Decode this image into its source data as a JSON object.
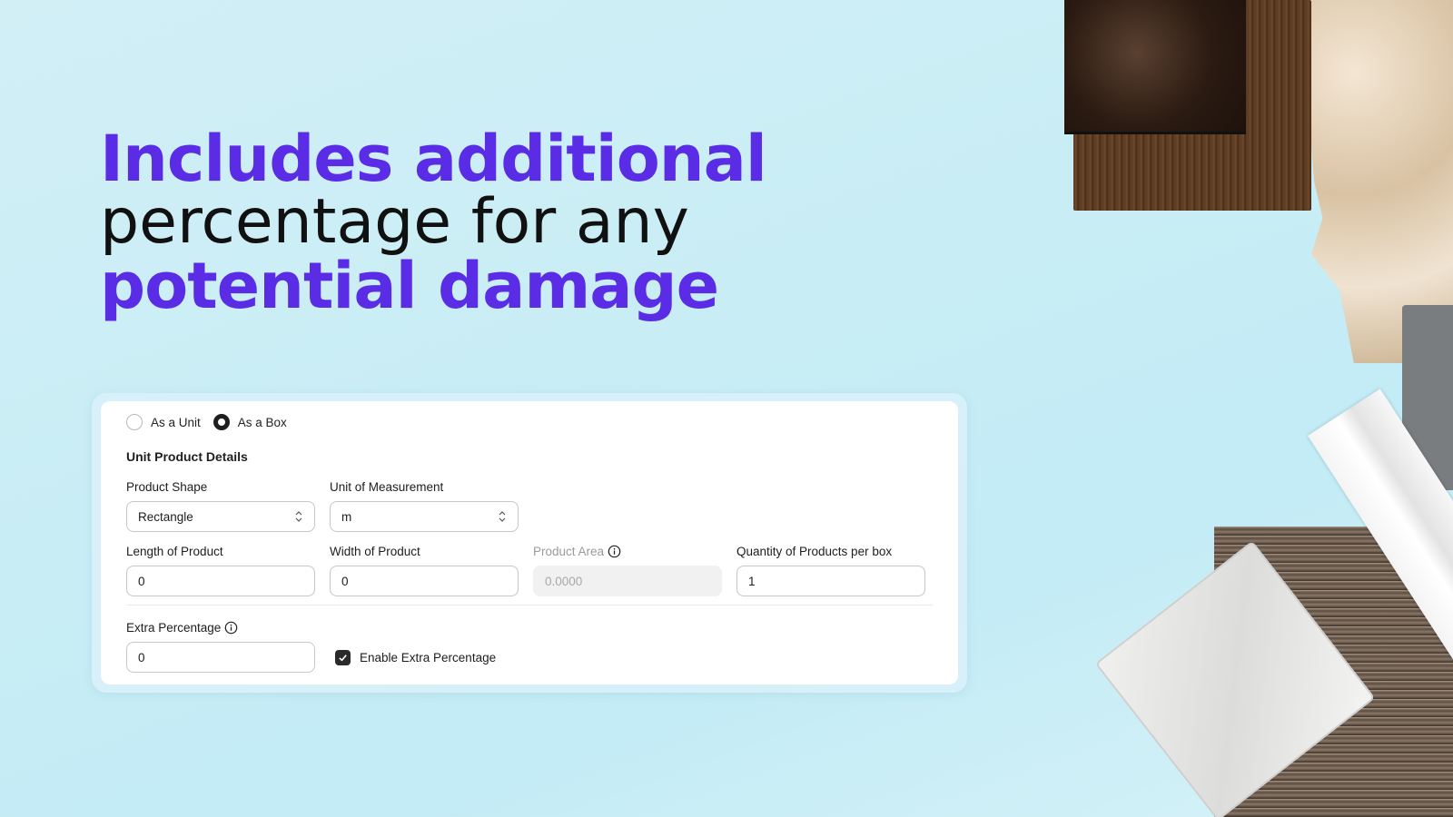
{
  "headline": {
    "line1": "Includes additional",
    "line2": "percentage for any",
    "line3": "potential damage"
  },
  "colors": {
    "accent": "#5a2ce6",
    "background": "#c8edf5"
  },
  "form": {
    "mode_options": [
      {
        "label": "As a Unit",
        "selected": false
      },
      {
        "label": "As a Box",
        "selected": true
      }
    ],
    "section_title": "Unit Product Details",
    "product_shape": {
      "label": "Product Shape",
      "value": "Rectangle",
      "icon": "chevron-up-down-icon"
    },
    "unit_of_measurement": {
      "label": "Unit of Measurement",
      "value": "m",
      "icon": "chevron-up-down-icon"
    },
    "length": {
      "label": "Length of Product",
      "value": "0"
    },
    "width": {
      "label": "Width of Product",
      "value": "0"
    },
    "area": {
      "label": "Product Area",
      "value": "0.0000",
      "icon": "info-icon",
      "disabled": true
    },
    "quantity_per_box": {
      "label": "Quantity of Products per box",
      "value": "1"
    },
    "extra_percentage": {
      "label": "Extra Percentage",
      "value": "0",
      "icon": "info-icon"
    },
    "enable_extra": {
      "label": "Enable Extra Percentage",
      "checked": true
    }
  },
  "images": [
    {
      "name": "marble-tile-sample",
      "description": "dark emperador marble tile"
    },
    {
      "name": "dark-wood-sample",
      "description": "dark oak wood plank"
    },
    {
      "name": "pearl-mosaic-sample",
      "description": "mother-of-pearl fan mosaic"
    },
    {
      "name": "grey-stone-sample",
      "description": "grey granite sample"
    },
    {
      "name": "white-molding-sample",
      "description": "white marble molding"
    },
    {
      "name": "ash-wood-sample",
      "description": "grey-brown ash wood plank"
    },
    {
      "name": "white-marble-tiles-sample",
      "description": "white marble pillow tiles"
    }
  ]
}
